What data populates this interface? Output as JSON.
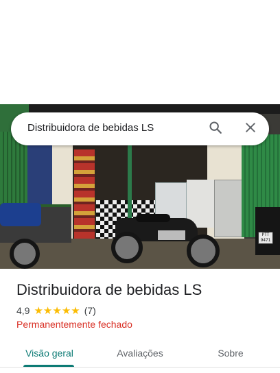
{
  "search": {
    "query": "Distribuidora de bebidas LS",
    "search_icon": "search-icon",
    "close_icon": "close-icon"
  },
  "photo": {
    "plate_text": "PTT 9471"
  },
  "place": {
    "name": "Distribuidora de bebidas LS",
    "rating": "4,9",
    "stars": 5,
    "review_count": "(7)",
    "status": "Permanentemente fechado"
  },
  "tabs": [
    {
      "label": "Visão geral",
      "active": true
    },
    {
      "label": "Avaliações",
      "active": false
    },
    {
      "label": "Sobre",
      "active": false
    }
  ],
  "colors": {
    "accent": "#0b7a74",
    "star": "#fbbc04",
    "status_closed": "#d93025"
  }
}
